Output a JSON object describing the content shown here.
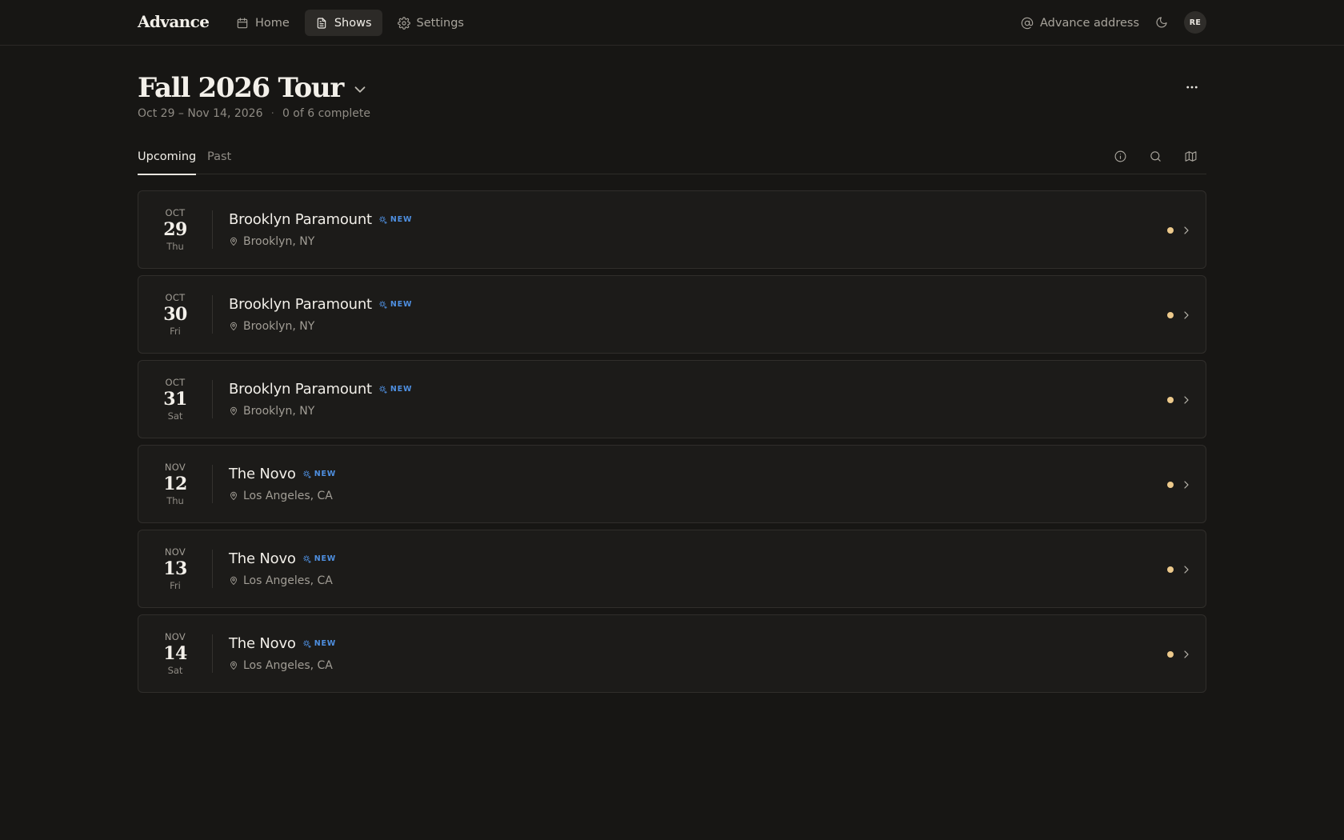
{
  "app": {
    "brand": "Advance"
  },
  "nav": {
    "items": [
      {
        "label": "Home",
        "icon": "calendar-icon",
        "active": false
      },
      {
        "label": "Shows",
        "icon": "document-icon",
        "active": true
      },
      {
        "label": "Settings",
        "icon": "gear-icon",
        "active": false
      }
    ]
  },
  "topbar": {
    "advance_address_label": "Advance address",
    "theme_icon": "moon-icon",
    "avatar_initials": "RE"
  },
  "tour": {
    "title": "Fall 2026 Tour",
    "date_range": "Oct 29 – Nov 14, 2026",
    "separator": "·",
    "progress": "0 of 6 complete"
  },
  "tabs": [
    {
      "label": "Upcoming",
      "active": true
    },
    {
      "label": "Past",
      "active": false
    }
  ],
  "toolbar_icons": [
    "info-icon",
    "search-icon",
    "map-icon"
  ],
  "shows": [
    {
      "month": "OCT",
      "day": "29",
      "weekday": "Thu",
      "venue": "Brooklyn Paramount",
      "badge": "NEW",
      "location": "Brooklyn, NY"
    },
    {
      "month": "OCT",
      "day": "30",
      "weekday": "Fri",
      "venue": "Brooklyn Paramount",
      "badge": "NEW",
      "location": "Brooklyn, NY"
    },
    {
      "month": "OCT",
      "day": "31",
      "weekday": "Sat",
      "venue": "Brooklyn Paramount",
      "badge": "NEW",
      "location": "Brooklyn, NY"
    },
    {
      "month": "NOV",
      "day": "12",
      "weekday": "Thu",
      "venue": "The Novo",
      "badge": "NEW",
      "location": "Los Angeles, CA"
    },
    {
      "month": "NOV",
      "day": "13",
      "weekday": "Fri",
      "venue": "The Novo",
      "badge": "NEW",
      "location": "Los Angeles, CA"
    },
    {
      "month": "NOV",
      "day": "14",
      "weekday": "Sat",
      "venue": "The Novo",
      "badge": "NEW",
      "location": "Los Angeles, CA"
    }
  ],
  "colors": {
    "background": "#171614",
    "card": "#1c1b19",
    "badge_blue": "#4e8fe0",
    "status_dot": "#ecc98b"
  }
}
